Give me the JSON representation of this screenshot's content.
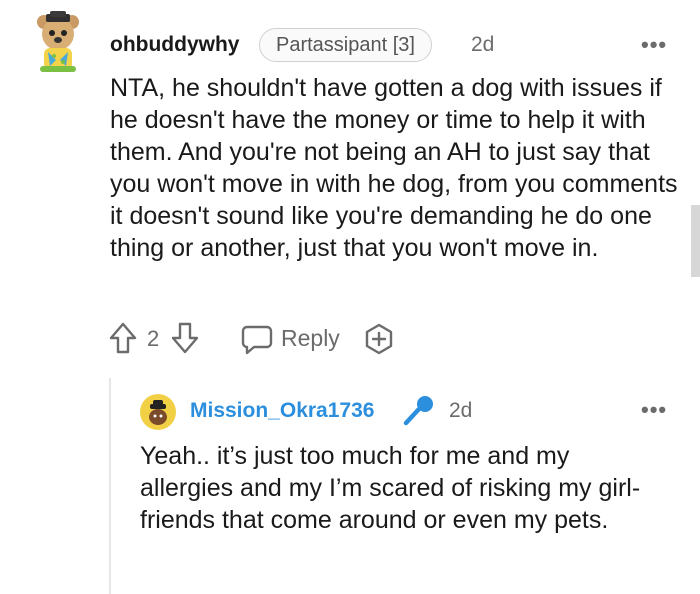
{
  "comment": {
    "username": "ohbuddywhy",
    "flair": "Partassipant [3]",
    "time": "2d",
    "more": "•••",
    "body": "NTA, he shouldn't have gotten a dog with issues if he doesn't have the money or time to help it with them. And you're not being an AH to just say that you won't move in with he dog, from you comments it doesn't sound like you're demanding he do one thing or another, just that you won't move in.",
    "votes": "2",
    "reply_label": "Reply"
  },
  "reply": {
    "username": "Mission_Okra1736",
    "time": "2d",
    "more": "•••",
    "body": "Yeah.. it’s just too much for me and my allergies and my I’m scared of risking my girl-friends that come around or even my pets."
  },
  "icons": {
    "upvote": "upvote-arrow-icon",
    "downvote": "downvote-arrow-icon",
    "reply": "speech-bubble-icon",
    "award": "add-award-icon",
    "op_badge": "microphone-icon"
  },
  "colors": {
    "username_blue": "#2c8fde",
    "text": "#1a1a1b",
    "muted": "#6b6b6b"
  }
}
